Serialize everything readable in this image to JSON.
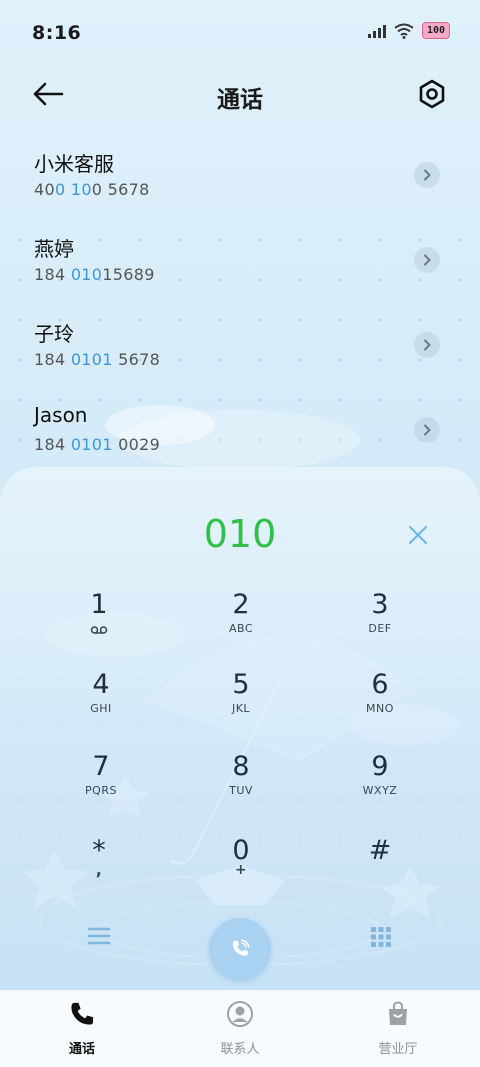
{
  "status_bar": {
    "time": "8:16",
    "battery": "100"
  },
  "header": {
    "title": "通话"
  },
  "contacts": [
    {
      "name": "小米客服",
      "num_pre": "40",
      "num_hl": "0 10",
      "num_post": "0 5678"
    },
    {
      "name": "燕婷",
      "num_pre": "184 ",
      "num_hl": "010",
      "num_post": "15689"
    },
    {
      "name": "子玲",
      "num_pre": "184 ",
      "num_hl": "0101",
      "num_post": " 5678"
    },
    {
      "name": "Jason",
      "num_pre": "184 ",
      "num_hl": "0101",
      "num_post": " 0029"
    }
  ],
  "dial": {
    "input": "010"
  },
  "keypad": [
    {
      "digit": "1",
      "letters": ""
    },
    {
      "digit": "2",
      "letters": "ABC"
    },
    {
      "digit": "3",
      "letters": "DEF"
    },
    {
      "digit": "4",
      "letters": "GHI"
    },
    {
      "digit": "5",
      "letters": "JKL"
    },
    {
      "digit": "6",
      "letters": "MNO"
    },
    {
      "digit": "7",
      "letters": "PQRS"
    },
    {
      "digit": "8",
      "letters": "TUV"
    },
    {
      "digit": "9",
      "letters": "WXYZ"
    },
    {
      "digit": "*",
      "letters": ","
    },
    {
      "digit": "0",
      "letters": "+"
    },
    {
      "digit": "#",
      "letters": ""
    }
  ],
  "bottom_nav": [
    {
      "label": "通话",
      "icon": "phone-icon",
      "active": true
    },
    {
      "label": "联系人",
      "icon": "person-icon",
      "active": false
    },
    {
      "label": "营业厅",
      "icon": "shopping-bag-icon",
      "active": false
    }
  ],
  "colors": {
    "accent": "#2fc04a",
    "highlight": "#3b97d8",
    "call_button": "#a9d2f2"
  }
}
